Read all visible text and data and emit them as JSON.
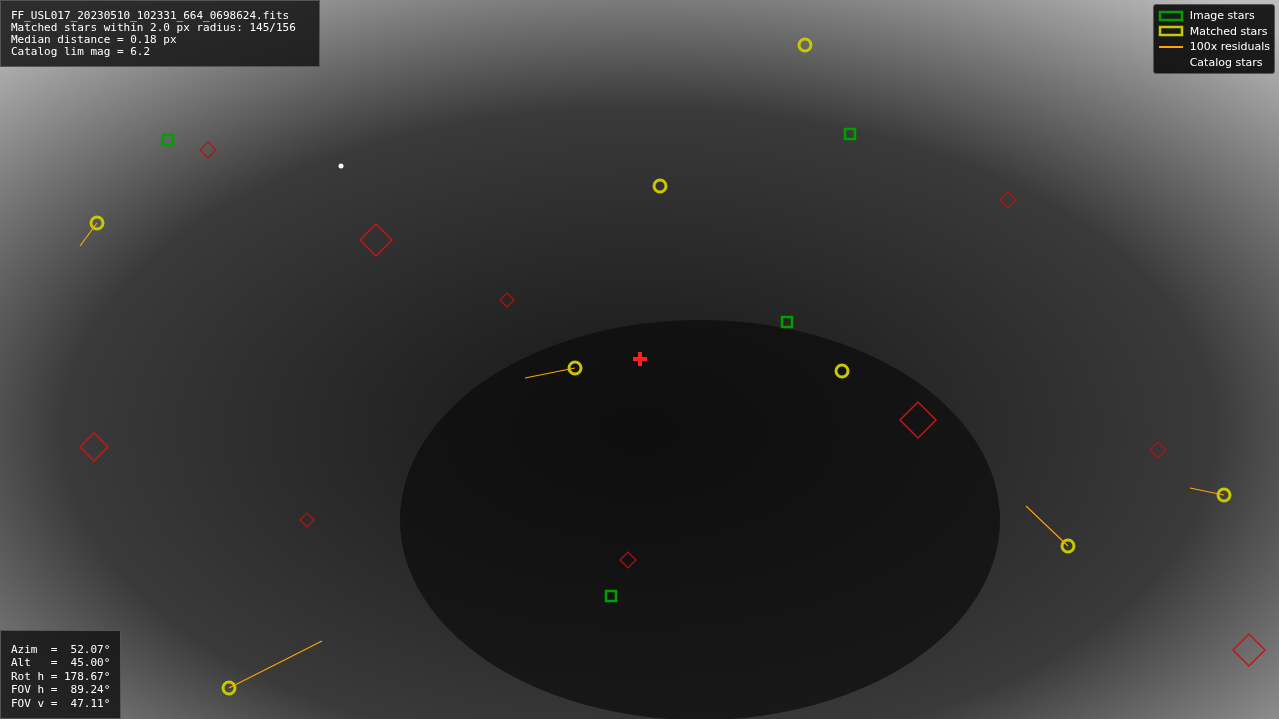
{
  "info_box": {
    "lines": [
      "FF_USL017_20230510_102331_664_0698624.fits",
      "Matched stars within 2.0 px radius: 145/156",
      "Median distance = 0.18 px",
      "Catalog lim mag = 6.2"
    ]
  },
  "legend": {
    "items": [
      {
        "label": "Image stars",
        "kind": "box",
        "color": "#00a000"
      },
      {
        "label": "Matched stars",
        "kind": "box",
        "color": "#c8c800"
      },
      {
        "label": "100x residuals",
        "kind": "line",
        "color": "#ffa500"
      },
      {
        "label": "Catalog stars"
      }
    ]
  },
  "pointing_box": {
    "lines": [
      "Azim  =  52.07°",
      "Alt   =  45.00°",
      "Rot h = 178.67°",
      "FOV h =  89.24°",
      "FOV v =  47.11°"
    ]
  }
}
